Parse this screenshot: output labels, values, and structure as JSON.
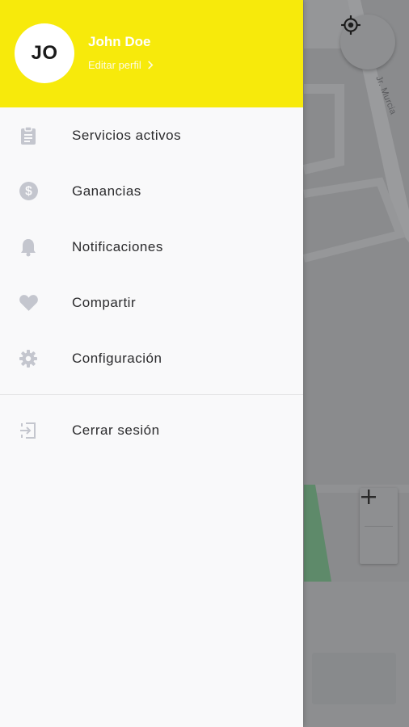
{
  "drawer": {
    "avatar_initials": "JO",
    "user_name": "John Doe",
    "edit_profile_label": "Editar perfil",
    "header_color": "#f7ea0b",
    "items": [
      {
        "label": "Servicios activos",
        "icon": "clipboard-icon"
      },
      {
        "label": "Ganancias",
        "icon": "dollar-coin-icon"
      },
      {
        "label": "Notificaciones",
        "icon": "bell-icon"
      },
      {
        "label": "Compartir",
        "icon": "heart-icon"
      },
      {
        "label": "Configuración",
        "icon": "gear-icon"
      }
    ],
    "logout": {
      "label": "Cerrar sesión",
      "icon": "logout-icon"
    }
  },
  "map": {
    "street_label": "Jr. Murcia",
    "zoom_in_label": "+",
    "zoom_out_label": "−"
  }
}
